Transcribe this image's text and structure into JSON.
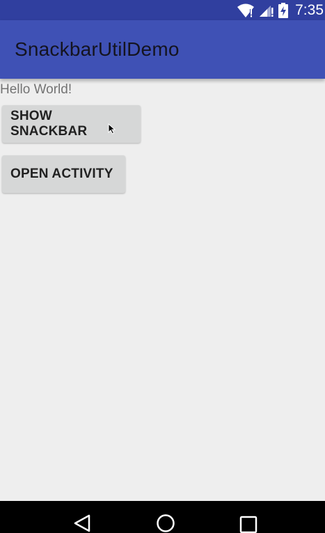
{
  "status_bar": {
    "time": "7:35",
    "icons": [
      "wifi-icon",
      "signal-icon",
      "battery-charging-icon"
    ]
  },
  "app_bar": {
    "title": "SnackbarUtilDemo"
  },
  "content": {
    "hello_text": "Hello World!",
    "show_snackbar_label": "SHOW SNACKBAR",
    "open_activity_label": "OPEN ACTIVITY"
  },
  "nav_bar": {
    "icons": [
      "back-icon",
      "home-icon",
      "recents-icon"
    ]
  },
  "colors": {
    "status_bar": "#303f9f",
    "app_bar": "#3f51b5",
    "background": "#eeeeee",
    "button": "#d6d7d7",
    "nav_bar": "#000000"
  }
}
